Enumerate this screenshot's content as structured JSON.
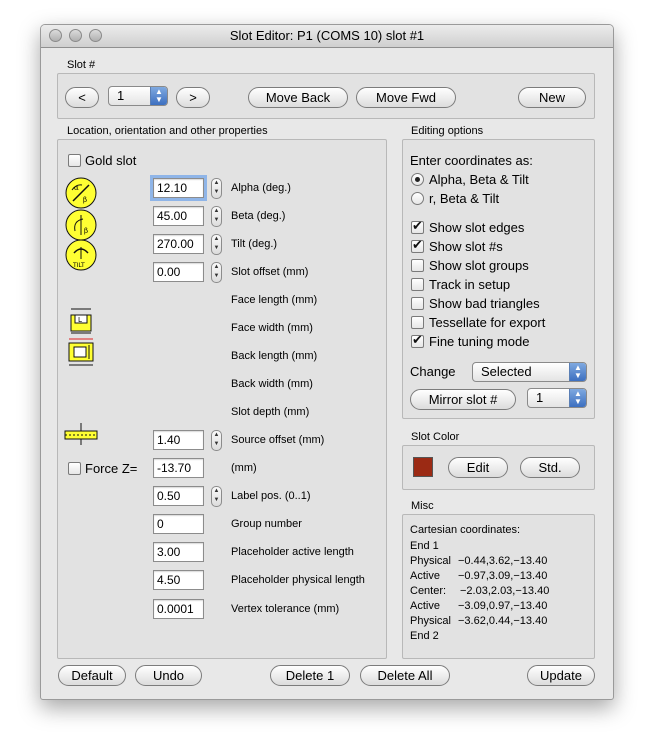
{
  "window": {
    "title": "Slot Editor: P1 (COMS 10) slot #1"
  },
  "slot_nav": {
    "group_label": "Slot #",
    "prev": "<",
    "next": ">",
    "slot_value": "1",
    "move_back": "Move Back",
    "move_fwd": "Move Fwd",
    "new": "New"
  },
  "location": {
    "group_label": "Location, orientation and other properties",
    "gold_slot": "Gold slot",
    "force_z": "Force Z=",
    "fields": {
      "alpha": {
        "value": "12.10",
        "label": "Alpha (deg.)"
      },
      "beta": {
        "value": "45.00",
        "label": "Beta (deg.)"
      },
      "tilt": {
        "value": "270.00",
        "label": "Tilt (deg.)"
      },
      "slot_offset": {
        "value": "0.00",
        "label": "Slot offset (mm)"
      },
      "source_offset": {
        "value": "1.40",
        "label": "Source offset (mm)"
      },
      "force_z": {
        "value": "-13.70",
        "label": "(mm)"
      },
      "label_pos": {
        "value": "0.50",
        "label": "Label pos. (0..1)"
      },
      "group_number": {
        "value": "0",
        "label": "Group number"
      },
      "placeholder_active": {
        "value": "3.00",
        "label": "Placeholder active length"
      },
      "placeholder_physical": {
        "value": "4.50",
        "label": "Placeholder physical length"
      },
      "vertex_tolerance": {
        "value": "0.0001",
        "label": "Vertex tolerance (mm)"
      }
    },
    "dimension_labels": {
      "face_length": "Face length (mm)",
      "face_width": "Face width (mm)",
      "back_length": "Back length (mm)",
      "back_width": "Back width (mm)",
      "slot_depth": "Slot depth (mm)"
    }
  },
  "editing": {
    "group_label": "Editing options",
    "enter_as": "Enter coordinates as:",
    "radio_abt": "Alpha, Beta & Tilt",
    "radio_rbt": "r, Beta & Tilt",
    "show_slot_edges": "Show slot edges",
    "show_slot_nums": "Show slot #s",
    "show_slot_groups": "Show slot groups",
    "track_in_setup": "Track in setup",
    "show_bad_triangles": "Show bad triangles",
    "tessellate_export": "Tessellate for export",
    "fine_tuning": "Fine tuning mode",
    "change_label": "Change",
    "change_value": "Selected",
    "mirror_button": "Mirror slot #",
    "mirror_value": "1"
  },
  "slot_color": {
    "group_label": "Slot Color",
    "swatch": "#9b2a14",
    "edit": "Edit",
    "std": "Std."
  },
  "misc": {
    "group_label": "Misc",
    "heading": "Cartesian coordinates:",
    "lines": [
      {
        "label": "End 1",
        "value": ""
      },
      {
        "label": "Physical",
        "value": "−0.44,3.62,−13.40"
      },
      {
        "label": "Active",
        "value": "−0.97,3.09,−13.40"
      },
      {
        "label": "Center:",
        "value": "−2.03,2.03,−13.40"
      },
      {
        "label": "Active",
        "value": "−3.09,0.97,−13.40"
      },
      {
        "label": "Physical",
        "value": "−3.62,0.44,−13.40"
      },
      {
        "label": "End 2",
        "value": ""
      }
    ]
  },
  "bottom": {
    "default": "Default",
    "undo": "Undo",
    "delete1": "Delete 1",
    "delete_all": "Delete All",
    "update": "Update"
  }
}
